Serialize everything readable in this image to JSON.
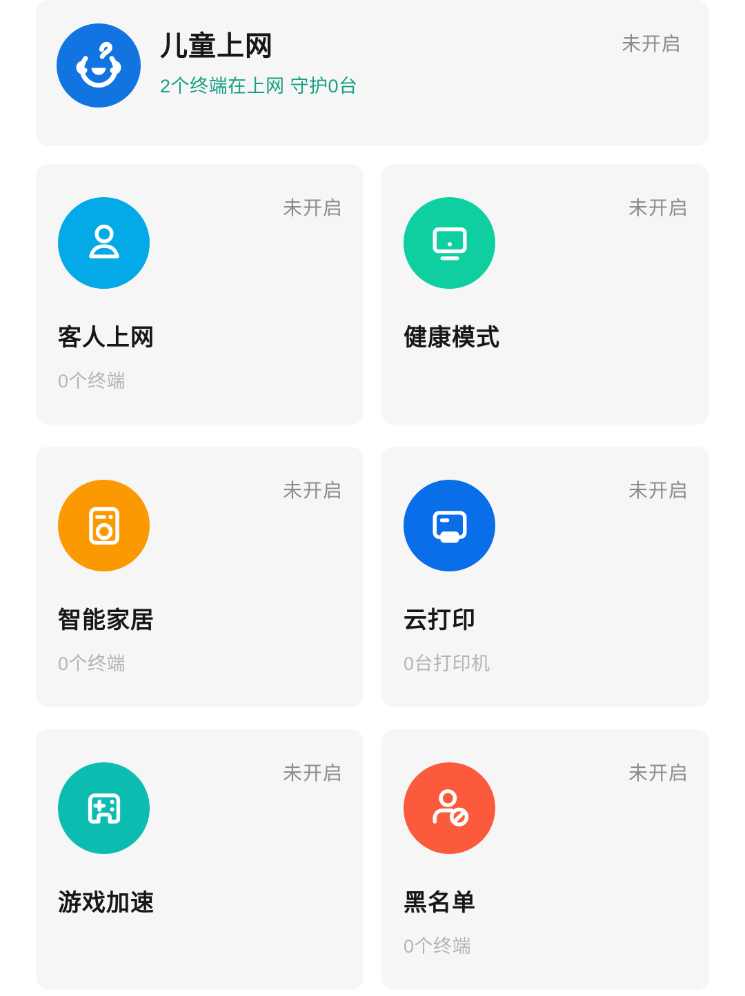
{
  "hero": {
    "icon_name": "baby-face-icon",
    "icon_color": "#1274e0",
    "title": "儿童上网",
    "subtitle": "2个终端在上网  守护0台",
    "subtitle_color": "#16a085",
    "status": "未开启"
  },
  "tiles": [
    {
      "icon_name": "guest-person-icon",
      "icon_color": "#04a9e8",
      "title": "客人上网",
      "subtitle": "0个终端",
      "status": "未开启"
    },
    {
      "icon_name": "monitor-icon",
      "icon_color": "#0fcfa0",
      "title": "健康模式",
      "subtitle": "",
      "status": "未开启"
    },
    {
      "icon_name": "washing-machine-icon",
      "icon_color": "#fb9902",
      "title": "智能家居",
      "subtitle": "0个终端",
      "status": "未开启"
    },
    {
      "icon_name": "printer-icon",
      "icon_color": "#0a6ee8",
      "title": "云打印",
      "subtitle": "0台打印机",
      "status": "未开启"
    },
    {
      "icon_name": "gamepad-icon",
      "icon_color": "#0cbcb0",
      "title": "游戏加速",
      "subtitle": "",
      "status": "未开启"
    },
    {
      "icon_name": "person-blocked-icon",
      "icon_color": "#fc5a3c",
      "title": "黑名单",
      "subtitle": "0个终端",
      "status": "未开启"
    }
  ],
  "theme": {
    "page_background": "#ffffff",
    "card_background": "#f6f6f6",
    "title_color": "#171717",
    "subtitle_color": "#b4b4b4",
    "status_color": "#8c8c8c"
  }
}
